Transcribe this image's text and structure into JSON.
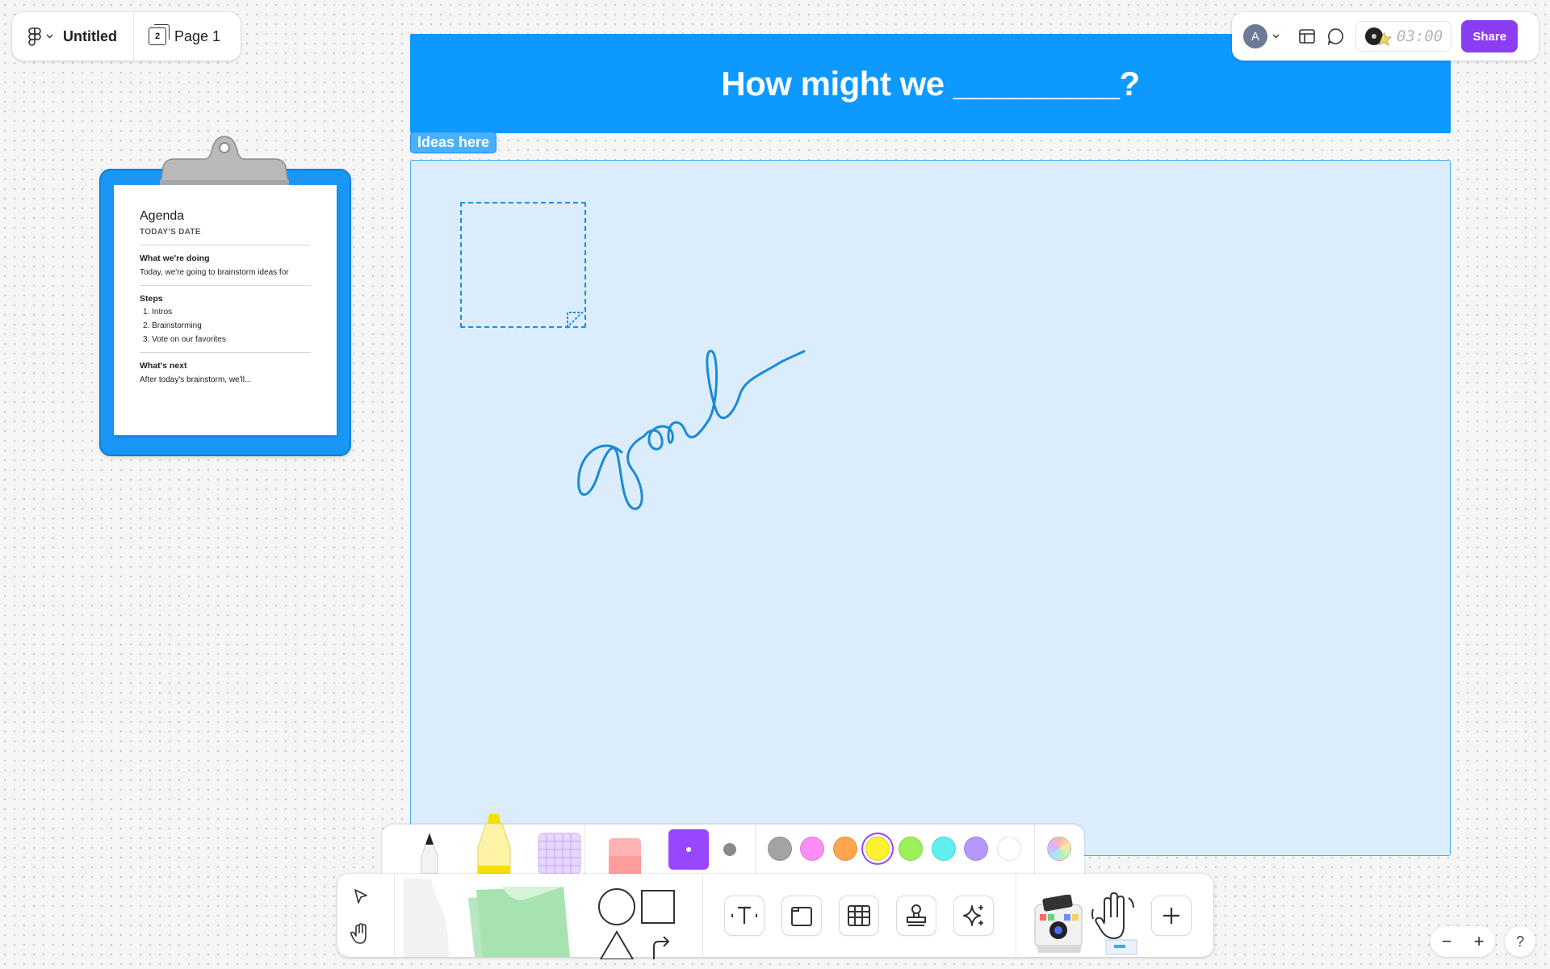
{
  "file": {
    "name": "Untitled",
    "page_label": "Page 1",
    "page_count": "2"
  },
  "toolbar_right": {
    "avatar_initial": "A",
    "timer": "03:00",
    "share_label": "Share"
  },
  "board": {
    "banner_title": "How might we _________?",
    "section_label": "Ideas here"
  },
  "agenda": {
    "title": "Agenda",
    "date": "TODAY'S DATE",
    "doing_heading": "What we're doing",
    "doing_text": "Today, we're going to brainstorm ideas for",
    "steps_heading": "Steps",
    "steps": [
      "1. Intros",
      "2. Brainstorming",
      "3. Vote on our favorites"
    ],
    "next_heading": "What's next",
    "next_text": "After today's brainstorm, we'll..."
  },
  "palette": {
    "colors": [
      "#a3a3a3",
      "#ff8df5",
      "#ffa54d",
      "#fff030",
      "#9cf05a",
      "#5fefee",
      "#b598ff",
      "#ffffff"
    ],
    "selected_color": "#fff030",
    "accent": "#8b3df2",
    "banner": "#0d99ff"
  },
  "icons": {
    "menu": "figjam-logo-icon",
    "cursor": "cursor-icon",
    "hand": "hand-icon",
    "text": "text-icon",
    "section": "section-icon",
    "table": "table-icon",
    "stamp": "stamp-icon",
    "ai": "sparkle-icon",
    "plus": "plus-icon"
  },
  "zoom": {
    "out": "−",
    "in": "+"
  },
  "help": "?"
}
